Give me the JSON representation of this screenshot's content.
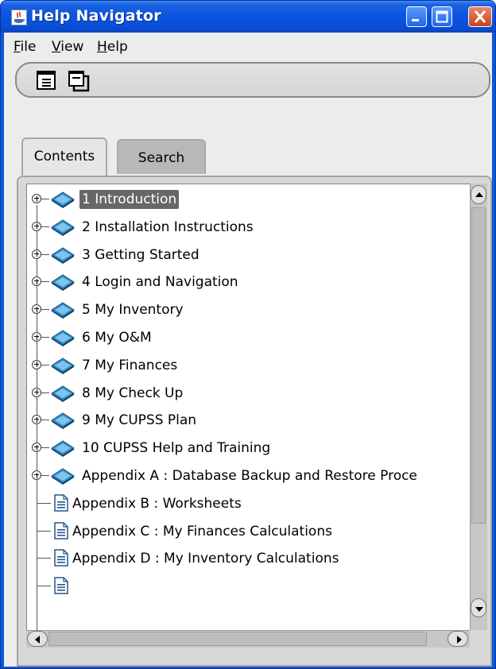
{
  "window": {
    "title": "Help Navigator",
    "buttons": [
      "minimize",
      "maximize",
      "close"
    ]
  },
  "menubar": {
    "items": [
      {
        "label": "File",
        "mnemonic": "F"
      },
      {
        "label": "View",
        "mnemonic": "V"
      },
      {
        "label": "Help",
        "mnemonic": "H"
      }
    ]
  },
  "toolbar": {
    "icons": [
      "hide-navigation-icon",
      "window-icon"
    ]
  },
  "tabs": [
    {
      "label": "Contents",
      "selected": true
    },
    {
      "label": "Search",
      "selected": false
    }
  ],
  "tree": {
    "items": [
      {
        "label": "1 Introduction",
        "type": "book",
        "selected": true
      },
      {
        "label": "2 Installation Instructions",
        "type": "book"
      },
      {
        "label": "3 Getting Started",
        "type": "book"
      },
      {
        "label": "4 Login and Navigation",
        "type": "book"
      },
      {
        "label": "5 My Inventory",
        "type": "book"
      },
      {
        "label": "6 My O&M",
        "type": "book"
      },
      {
        "label": "7 My Finances",
        "type": "book"
      },
      {
        "label": "8 My Check Up",
        "type": "book"
      },
      {
        "label": "9 My CUPSS Plan",
        "type": "book"
      },
      {
        "label": "10 CUPSS Help and Training",
        "type": "book"
      },
      {
        "label": "Appendix A : Database Backup and Restore Proce",
        "type": "book"
      },
      {
        "label": "Appendix B : Worksheets",
        "type": "page"
      },
      {
        "label": "Appendix C : My Finances Calculations",
        "type": "page"
      },
      {
        "label": "Appendix D : My Inventory Calculations",
        "type": "page"
      },
      {
        "label": "",
        "type": "page"
      }
    ]
  },
  "colors": {
    "titlebar": "#0b55e1",
    "selection": "#676767",
    "book_icon": "#2f8fc8"
  }
}
